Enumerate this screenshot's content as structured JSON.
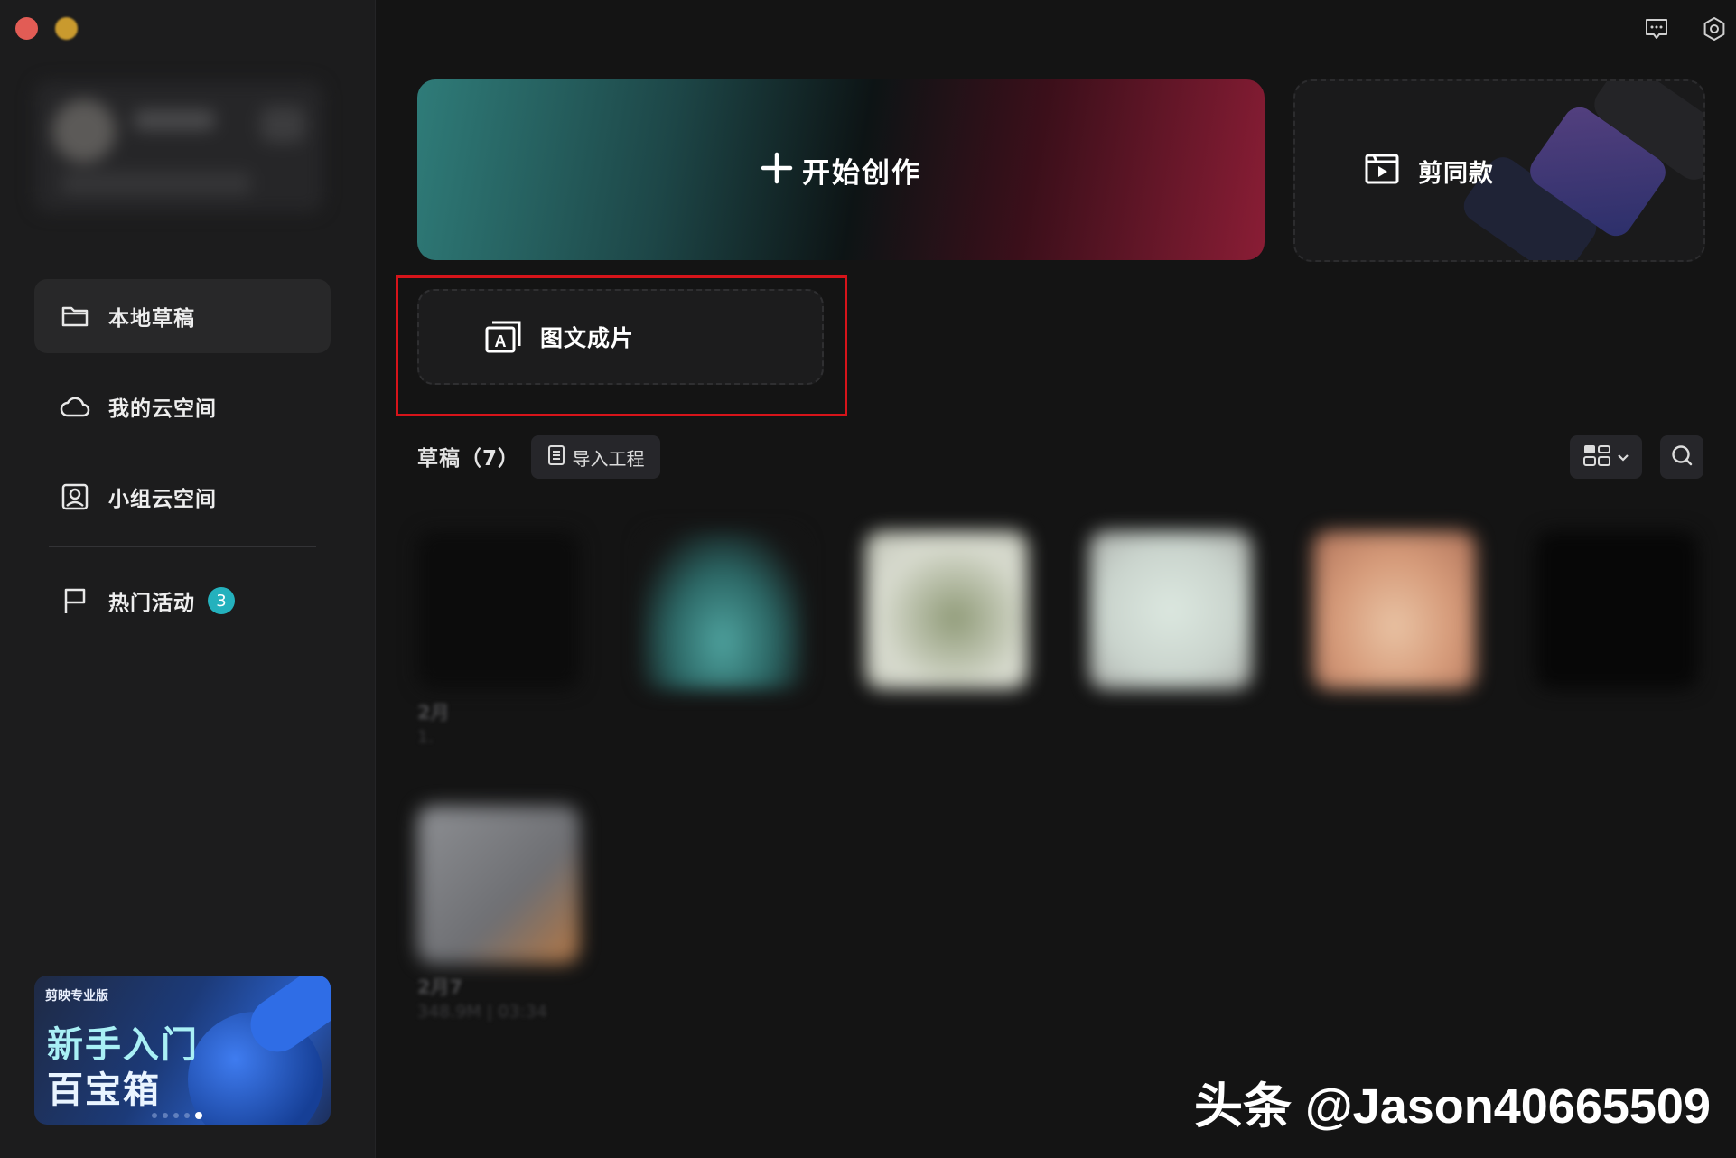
{
  "sidebar": {
    "items": [
      {
        "label": "本地草稿",
        "icon": "folder-icon"
      },
      {
        "label": "我的云空间",
        "icon": "cloud-icon"
      },
      {
        "label": "小组云空间",
        "icon": "team-space-icon"
      },
      {
        "label": "热门活动",
        "icon": "flag-icon",
        "badge": "3"
      }
    ],
    "banner": {
      "brand": "剪映专业版",
      "title_line1": "新手入门",
      "title_line2": "百宝箱"
    }
  },
  "header": {
    "feedback_icon": "feedback-icon",
    "settings_icon": "settings-icon"
  },
  "create": {
    "start_label": "开始创作",
    "template_label": "剪同款",
    "image_to_video_label": "图文成片"
  },
  "drafts": {
    "title": "草稿（7）",
    "import_label": "导入工程",
    "items": [
      {
        "name": "2月",
        "meta": "1."
      },
      {
        "name": "",
        "meta": ""
      },
      {
        "name": "",
        "meta": ""
      },
      {
        "name": "",
        "meta": ""
      },
      {
        "name": "",
        "meta": ""
      },
      {
        "name": "",
        "meta": ""
      },
      {
        "name": "2月7",
        "meta": "348.9M | 03:34"
      }
    ]
  },
  "watermark": "头条 @Jason40665509",
  "colors": {
    "accent_badge": "#24b1bd",
    "highlight_border": "#d6141a",
    "background": "#141414",
    "sidebar": "#1c1c1d"
  }
}
